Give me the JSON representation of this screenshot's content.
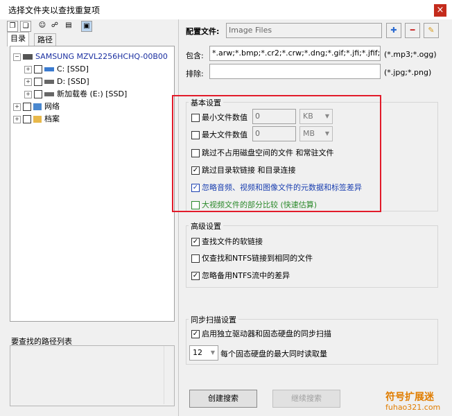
{
  "window": {
    "title": "选择文件夹以查找重复项",
    "close_glyph": "×"
  },
  "left": {
    "tabs": [
      "目录",
      "路径"
    ],
    "tree": [
      {
        "label": "SAMSUNG MZVL2256HCHQ-00B00",
        "level": 0
      },
      {
        "label": "C: [SSD]",
        "level": 1
      },
      {
        "label": "D: [SSD]",
        "level": 1
      },
      {
        "label": "新加载卷 (E:) [SSD]",
        "level": 1
      },
      {
        "label": "网络",
        "level": 0
      },
      {
        "label": "档案",
        "level": 0
      }
    ],
    "paths_title": "要查找的路径列表"
  },
  "config": {
    "label": "配置文件:",
    "value": "Image Files",
    "add_glyph": "✚",
    "remove_glyph": "━",
    "edit_glyph": "✎"
  },
  "include": {
    "label": "包含:",
    "value": "*.arw;*.bmp;*.cr2;*.crw;*.dng;*.gif;*.jfi;*.jfif;*.jif;*.jls;",
    "hint": "(*.mp3;*.ogg)"
  },
  "exclude": {
    "label": "排除:",
    "value": "",
    "hint": "(*.jpg;*.png)"
  },
  "basic": {
    "title": "基本设置",
    "min_size_label": "最小文件数值",
    "min_size_value": "0",
    "min_size_unit": "KB",
    "max_size_label": "最大文件数值",
    "max_size_value": "0",
    "max_size_unit": "MB",
    "opt_skip_offline": "跳过不占用磁盘空间的文件 和常驻文件",
    "opt_skip_symlinks": "跳过目录软链接 和目录连接",
    "opt_ignore_meta": "忽略音频、视频和图像文件的元数据和标签差异",
    "opt_partial_video": "大视频文件的部分比较 (快速估算)"
  },
  "advanced": {
    "title": "高级设置",
    "opt_find_softlinks": "查找文件的软链接",
    "opt_ntfs_links": "仅查找和NTFS链接到相同的文件",
    "opt_ignore_streams": "忽略备用NTFS流中的差异"
  },
  "sync": {
    "title": "同步扫描设置",
    "opt_enable_sync": "启用独立驱动器和固态硬盘的同步扫描",
    "max_reads_value": "12",
    "max_reads_label": "每个固态硬盘的最大同时读取量"
  },
  "buttons": {
    "create": "创建搜索",
    "continue": "继续搜索"
  },
  "watermark": {
    "line1": "符号扩展迷",
    "line2": "fuhao321.com"
  }
}
